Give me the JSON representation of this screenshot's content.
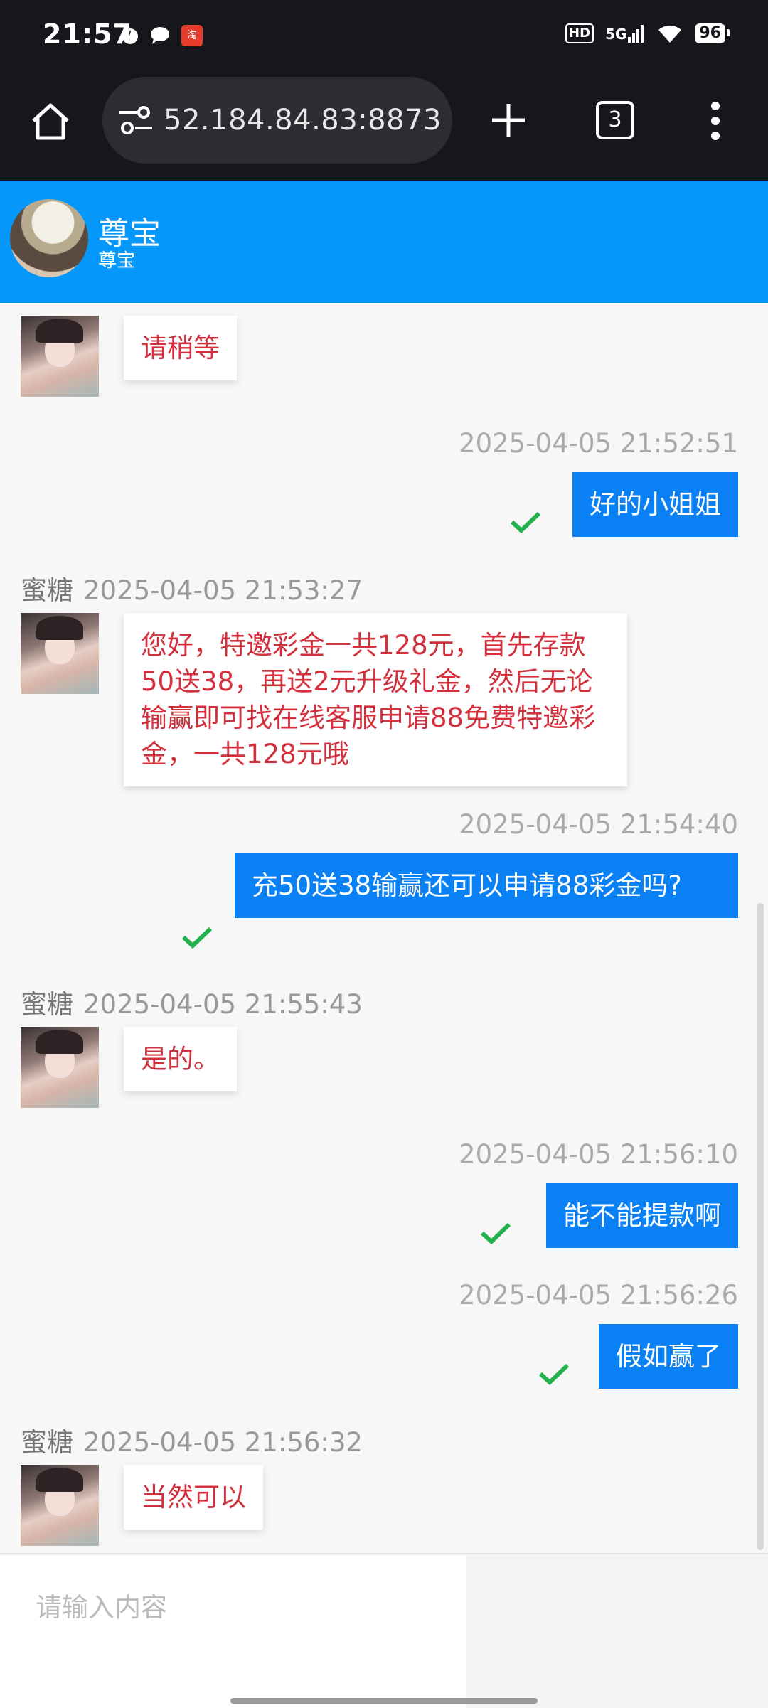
{
  "status_bar": {
    "time": "21:57",
    "left_icons": [
      "fire-icon",
      "chat-icon",
      "taobao-icon"
    ],
    "hd": "HD",
    "network": "5G",
    "battery": "96"
  },
  "browser": {
    "url": "52.184.84.83:8873",
    "tab_count": "3"
  },
  "chat_header": {
    "name": "尊宝",
    "subtitle": "尊宝"
  },
  "messages": [
    {
      "side": "in",
      "text": "请稍等"
    },
    {
      "side": "out",
      "time": "2025-04-05 21:52:51",
      "text": "好的小姐姐",
      "status": "sent-check"
    },
    {
      "side": "in",
      "sender": "蜜糖",
      "time": "2025-04-05 21:53:27",
      "text": "您好，特邀彩金一共128元，首先存款50送38，再送2元升级礼金，然后无论输赢即可找在线客服申请88免费特邀彩金，一共128元哦"
    },
    {
      "side": "out",
      "time": "2025-04-05 21:54:40",
      "text": "充50送38输赢还可以申请88彩金吗?",
      "status": "sent-check"
    },
    {
      "side": "in",
      "sender": "蜜糖",
      "time": "2025-04-05 21:55:43",
      "text": "是的。"
    },
    {
      "side": "out",
      "time": "2025-04-05 21:56:10",
      "text": "能不能提款啊",
      "status": "sent-check"
    },
    {
      "side": "out",
      "time": "2025-04-05 21:56:26",
      "text": "假如赢了",
      "status": "sent-check"
    },
    {
      "side": "in",
      "sender": "蜜糖",
      "time": "2025-04-05 21:56:32",
      "text": "当然可以"
    }
  ],
  "input": {
    "placeholder": "请输入内容"
  },
  "colors": {
    "header_blue": "#0598fa",
    "outgoing_bubble": "#0a80f5",
    "incoming_text": "#d1303c",
    "check_green": "#22b14c"
  }
}
